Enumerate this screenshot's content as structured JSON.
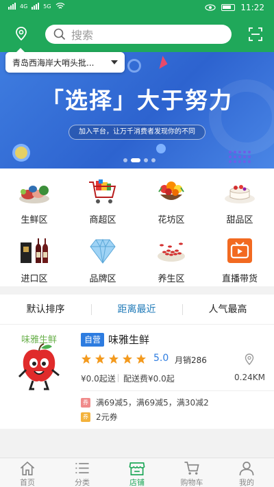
{
  "status_bar": {
    "network_left": "4G",
    "network_right": "5G",
    "time": "11:22"
  },
  "header": {
    "search_placeholder": "搜索"
  },
  "location_popup": {
    "text": "青岛西海岸大哨头批..."
  },
  "banner": {
    "headline": "「选择」大于努力",
    "subline": "加入平台，让万千消费者发现你的不同"
  },
  "categories": [
    {
      "label": "生鲜区",
      "icon": "fresh-produce-icon"
    },
    {
      "label": "商超区",
      "icon": "shopping-cart-icon"
    },
    {
      "label": "花坊区",
      "icon": "flower-basket-icon"
    },
    {
      "label": "甜品区",
      "icon": "dessert-icon"
    },
    {
      "label": "进口区",
      "icon": "wine-bottles-icon"
    },
    {
      "label": "品牌区",
      "icon": "diamond-icon"
    },
    {
      "label": "养生区",
      "icon": "goji-berry-icon"
    },
    {
      "label": "直播带货",
      "icon": "live-tv-icon"
    }
  ],
  "sort_tabs": [
    {
      "label": "默认排序",
      "active": false
    },
    {
      "label": "距离最近",
      "active": true
    },
    {
      "label": "人气最高",
      "active": false
    }
  ],
  "store": {
    "logo_text": "味雅生鲜",
    "tag": "自营",
    "name": "味雅生鲜",
    "rating": "5.0",
    "stars": 5,
    "monthly_sales": "月销286",
    "min_order": "¥0.0起送",
    "delivery_fee": "配送费¥0.0起",
    "distance": "0.24KM",
    "promotions": [
      {
        "badge": "券",
        "badge_color": "#f08a8a",
        "text": "满69减5，满69减5，满30减2"
      },
      {
        "badge": "券",
        "badge_color": "#f3b23c",
        "text": "2元券"
      }
    ]
  },
  "bottom_nav": [
    {
      "label": "首页",
      "icon": "home-icon",
      "active": false
    },
    {
      "label": "分类",
      "icon": "list-icon",
      "active": false
    },
    {
      "label": "店铺",
      "icon": "store-icon",
      "active": true
    },
    {
      "label": "购物车",
      "icon": "cart-icon",
      "active": false
    },
    {
      "label": "我的",
      "icon": "profile-icon",
      "active": false
    }
  ],
  "colors": {
    "brand_green": "#20a85a",
    "accent_blue": "#2d7ce0",
    "star_orange": "#f39a1e"
  }
}
